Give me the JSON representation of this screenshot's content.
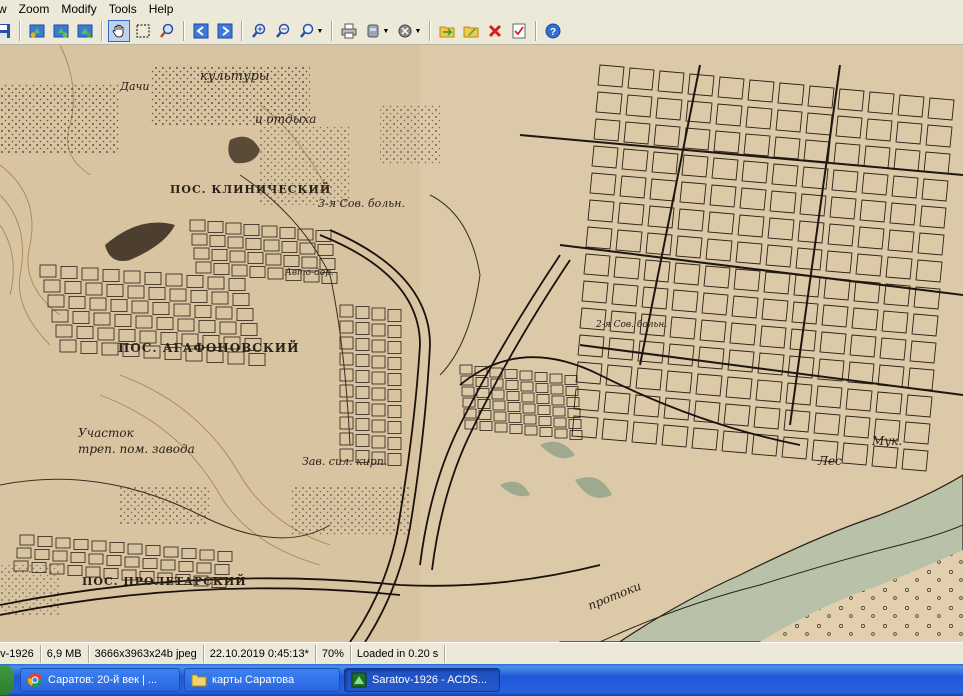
{
  "menu": {
    "items": [
      "w",
      "Zoom",
      "Modify",
      "Tools",
      "Help"
    ]
  },
  "toolbar": {
    "buttons": [
      "save-icon",
      "rotate-left-icon",
      "rotate-right-icon",
      "fit-icon",
      "hand-pan-icon",
      "select-rect-icon",
      "zoom-lens-icon",
      "prev-image-icon",
      "next-image-icon",
      "zoom-in-icon",
      "zoom-out-icon",
      "zoom-dropdown-icon",
      "print-icon",
      "scanner-dropdown-icon",
      "filter-dropdown-icon",
      "open-folder-icon",
      "edit-icon",
      "delete-icon",
      "properties-icon",
      "help-icon"
    ]
  },
  "map": {
    "labels": {
      "kultury": "культуры",
      "dachi": "Дачи",
      "otdykha": "и отдыха",
      "pos_klinichesky": "ПОС. КЛИНИЧЕСКИЙ",
      "sov_boln": "3-я Сов. больн.",
      "avto_dor": "Авто-дор.",
      "pos_agafonovsky": "ПОС. АГАФОНОВСКИЙ",
      "uchastok": "Участок",
      "trep_pom": "треп. пом. завода",
      "zav_sil_kirp": "Зав. сил. кирп.",
      "pos_proletarsky": "ПОС. ПРОЛЕТАРСКИЙ",
      "protok": "протоки",
      "les": "Лес",
      "muk": "Мук.",
      "sov_boln2": "2-я Сов. больн."
    }
  },
  "status": {
    "filename": "ov-1926",
    "filesize": "6,9 MB",
    "dims": "3666x3963x24b jpeg",
    "datetime": "22.10.2019 0:45:13*",
    "zoom": "70%",
    "loaded": "Loaded in 0.20 s"
  },
  "taskbar": {
    "tasks": [
      {
        "label": "Саратов: 20-й век | ...",
        "icon": "chrome-icon"
      },
      {
        "label": "карты Саратова",
        "icon": "folder-icon"
      },
      {
        "label": "Saratov-1926 - ACDS...",
        "icon": "acdsee-icon"
      }
    ]
  },
  "colors": {
    "paper": "#d9c8a8",
    "ink": "#2a2118",
    "river": "#a9b39a",
    "accent": "#316ac5"
  }
}
